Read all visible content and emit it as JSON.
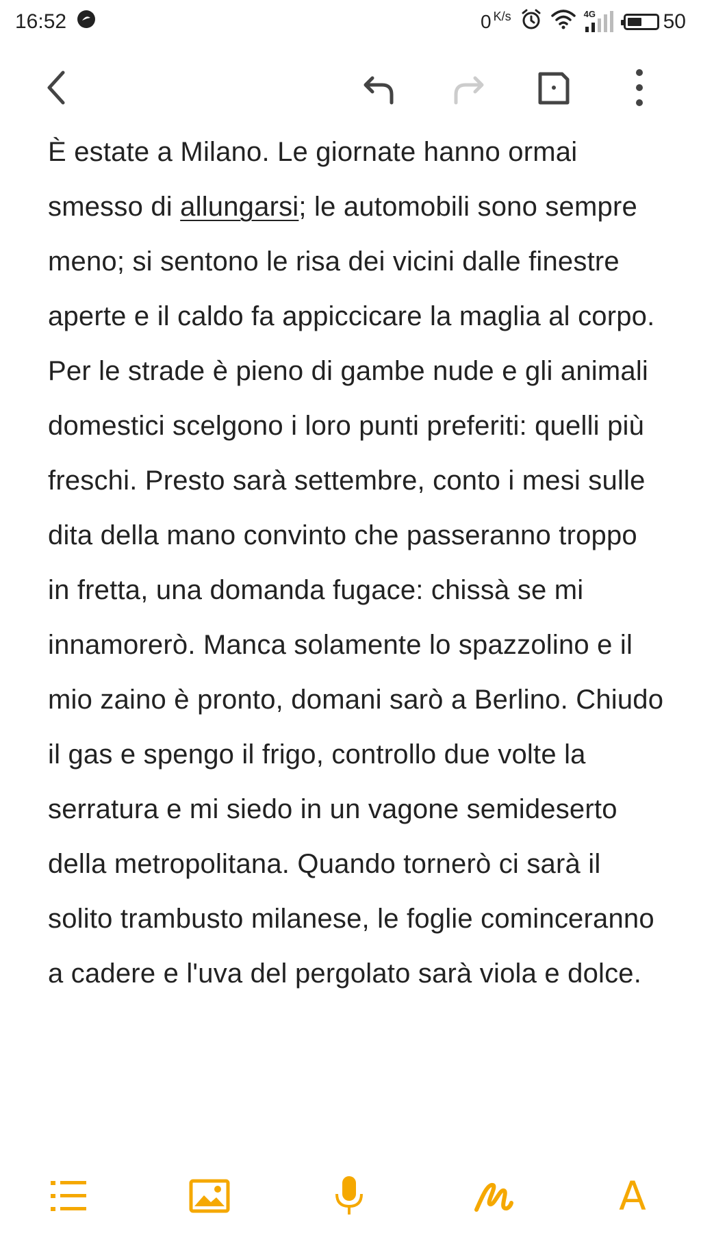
{
  "status_bar": {
    "time": "16:52",
    "net_speed_value": "0",
    "net_speed_unit": "K/s",
    "network_type": "4G",
    "battery_level": "50",
    "battery_fraction": 0.5
  },
  "toolbar": {
    "icons": [
      "chevron-left-icon",
      "undo-icon",
      "redo-icon",
      "save-icon",
      "more-vertical-icon"
    ]
  },
  "note": {
    "text_before_underline": "È estate a Milano. Le giornate hanno ormai smesso di ",
    "underlined_word": "allungarsi",
    "text_after_underline": "; le automobili sono sempre meno; si sentono le risa dei vicini dalle finestre aperte e il caldo fa appiccicare la maglia al corpo. Per le strade è pieno di gambe nude e gli animali domestici scelgono i loro punti preferiti: quelli più freschi. Presto sarà settembre, conto i mesi sulle dita della mano convinto che passeranno troppo in fretta, una domanda fugace: chissà se mi innamorerò. Manca solamente lo spazzolino e il mio zaino è pronto, domani sarò a Berlino. Chiudo il gas e spengo il frigo, controllo due volte la serratura e mi siedo in un vagone semideserto della metropolitana. Quando tornerò ci sarà il solito trambusto milanese, le foglie cominceranno a cadere e l'uva del pergolato sarà viola e dolce."
  },
  "format_bar": {
    "accent_color": "#f5a800",
    "font_button_label": "A",
    "icons": [
      "list-icon",
      "image-icon",
      "microphone-icon",
      "handwriting-icon",
      "font-icon"
    ]
  },
  "colors": {
    "icon_dark": "#444444",
    "icon_disabled": "#cccccc",
    "text": "#222222",
    "accent": "#f5a800"
  }
}
